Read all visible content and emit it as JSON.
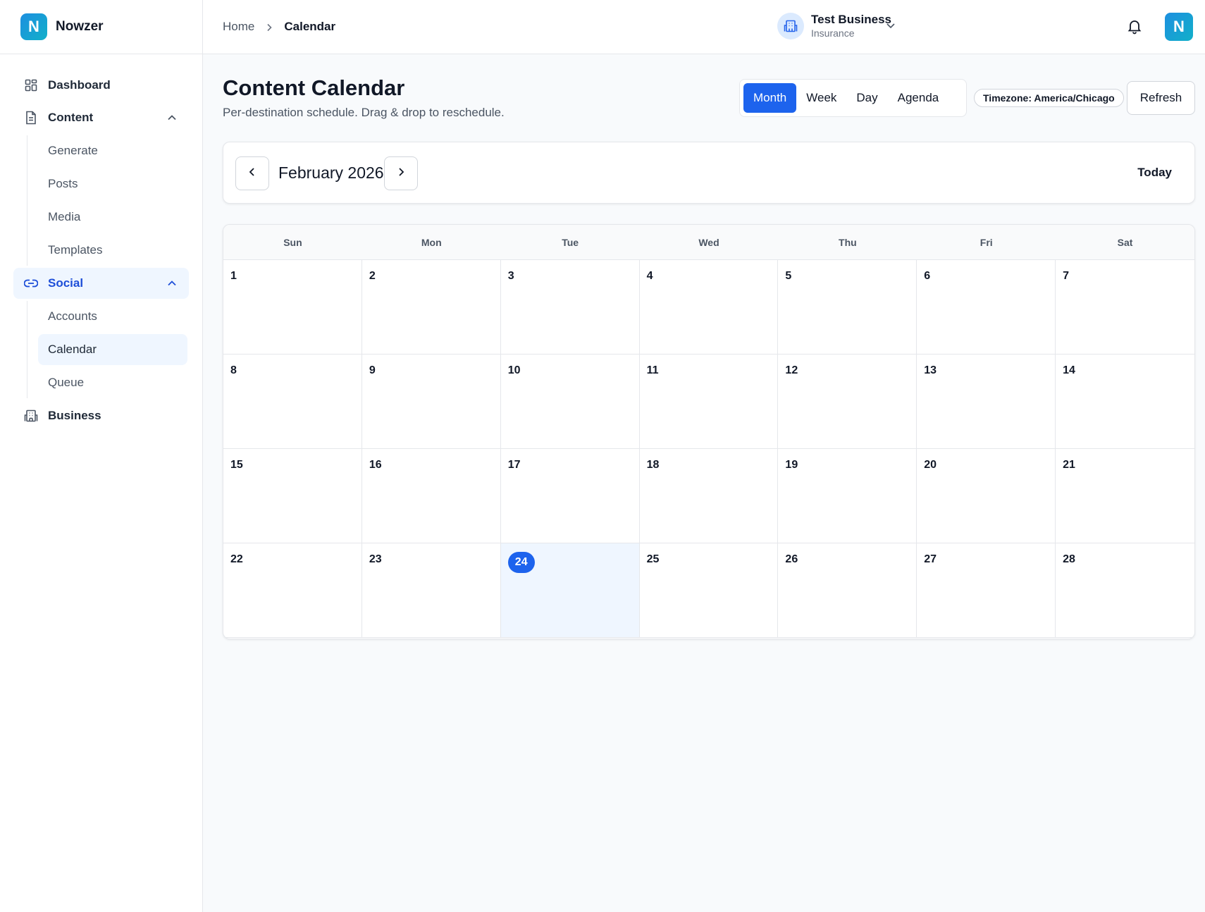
{
  "brand": {
    "logo_letter": "N",
    "name": "Nowzer"
  },
  "sidebar": {
    "items": [
      {
        "label": "Dashboard",
        "icon": "dashboard-grid-icon"
      },
      {
        "label": "Content",
        "icon": "document-icon",
        "expanded": true,
        "children": [
          "Generate",
          "Posts",
          "Media",
          "Templates"
        ]
      },
      {
        "label": "Social",
        "icon": "link-icon",
        "expanded": true,
        "active": true,
        "children": [
          "Accounts",
          "Calendar",
          "Queue"
        ],
        "current_child": "Calendar"
      },
      {
        "label": "Business",
        "icon": "building-icon"
      }
    ]
  },
  "header": {
    "breadcrumb": {
      "home": "Home",
      "current": "Calendar"
    },
    "business": {
      "name": "Test Business",
      "type": "Insurance",
      "icon": "building-icon"
    },
    "notifications_icon": "bell-icon",
    "avatar_letter": "N"
  },
  "page": {
    "title": "Content Calendar",
    "subtitle": "Per-destination schedule. Drag & drop to reschedule.",
    "views": [
      "Month",
      "Week",
      "Day",
      "Agenda"
    ],
    "active_view": "Month",
    "timezone": "Timezone: America/Chicago",
    "refresh_label": "Refresh"
  },
  "calendar": {
    "month_label": "February 2026",
    "today_label": "Today",
    "weekdays": [
      "Sun",
      "Mon",
      "Tue",
      "Wed",
      "Thu",
      "Fri",
      "Sat"
    ],
    "days": [
      "1",
      "2",
      "3",
      "4",
      "5",
      "6",
      "7",
      "8",
      "9",
      "10",
      "11",
      "12",
      "13",
      "14",
      "15",
      "16",
      "17",
      "18",
      "19",
      "20",
      "21",
      "22",
      "23",
      "24",
      "25",
      "26",
      "27",
      "28"
    ],
    "today": "24",
    "accent_color": "#1d63ed"
  }
}
